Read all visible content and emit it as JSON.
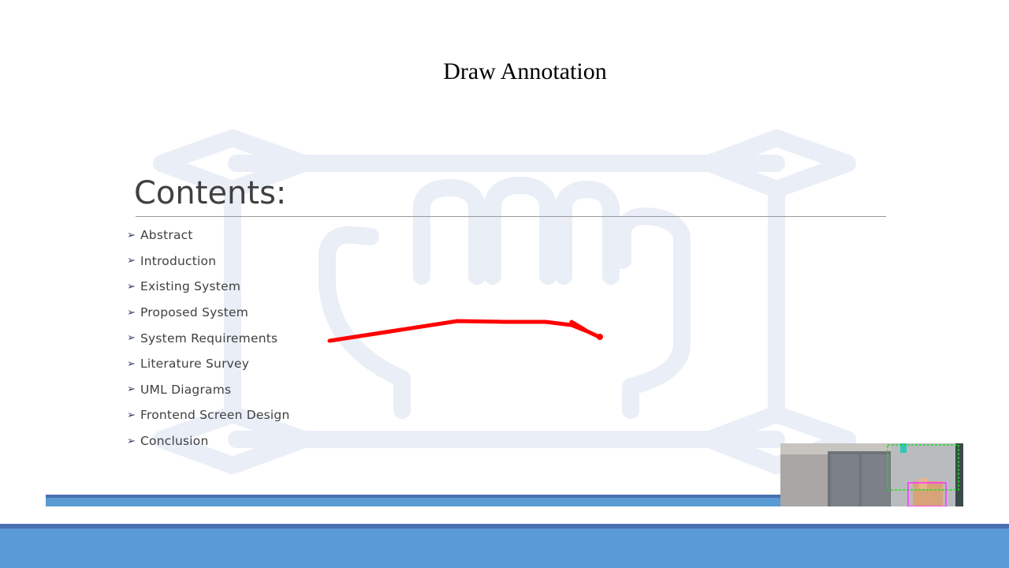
{
  "app": {
    "mode_title": "Draw Annotation"
  },
  "slide": {
    "heading": "Contents:",
    "bullet_glyph": "➢",
    "items": [
      "Abstract",
      "Introduction",
      "Existing System",
      "Proposed System",
      "System Requirements",
      "Literature Survey",
      "UML Diagrams",
      "Frontend Screen Design",
      "Conclusion"
    ]
  },
  "annotation": {
    "stroke_color": "#ff0000"
  },
  "theme": {
    "watermark_color": "#e9eef7",
    "footer_accent": "#5b9bd5",
    "footer_dark": "#4a6fb0"
  },
  "camera": {
    "detection_box_color": "#22dd22",
    "hand_box_color": "#ff33ff"
  }
}
